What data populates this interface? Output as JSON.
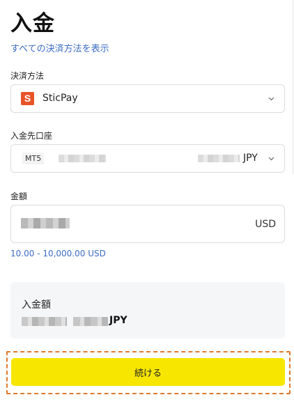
{
  "header": {
    "title": "入金",
    "show_all_link": "すべての決済方法を表示"
  },
  "payment_method": {
    "label": "決済方法",
    "logo_letter": "S",
    "selected": "SticPay",
    "logo_color": "#e8542a"
  },
  "deposit_account": {
    "label": "入金先口座",
    "platform": "MT5",
    "currency": "JPY"
  },
  "amount": {
    "label": "金額",
    "currency": "USD",
    "range": "10.00 - 10,000.00 USD"
  },
  "summary": {
    "label": "入金額",
    "currency": "JPY"
  },
  "actions": {
    "continue_label": "続ける",
    "button_color": "#f7e600",
    "focus_color": "#e07a2c"
  },
  "colors": {
    "link": "#3d6cc4"
  }
}
